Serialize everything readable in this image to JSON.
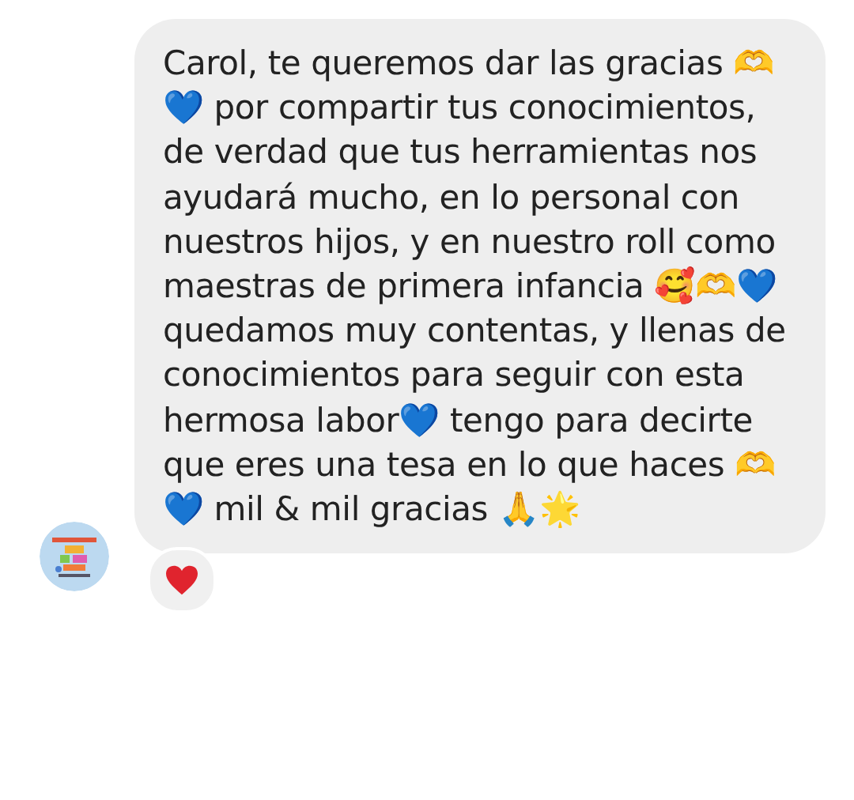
{
  "message": {
    "text": "Carol, te queremos dar las gracias 🫶💙 por compartir tus conocimientos, de verdad que tus herramientas nos ayudará mucho, en lo personal con nuestros hijos, y en nuestro roll como maestras de primera infancia 🥰🫶💙 quedamos muy contentas, y llenas de conocimientos para seguir con esta hermosa labor💙 tengo para decirte que eres una tesa en lo que haces 🫶💙 mil & mil gracias 🙏🌟",
    "reaction": {
      "kind": "heart"
    }
  }
}
